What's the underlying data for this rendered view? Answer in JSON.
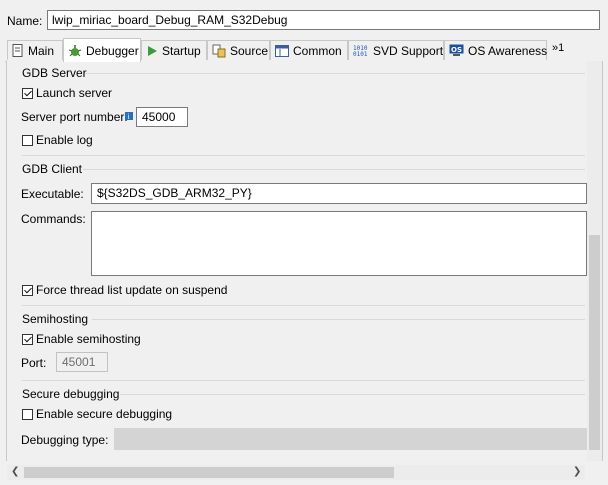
{
  "name_label": "Name:",
  "name_value": "lwip_miriac_board_Debug_RAM_S32Debug",
  "tabs": [
    {
      "label": "Main",
      "icon": "main-icon"
    },
    {
      "label": "Debugger",
      "icon": "debugger-icon"
    },
    {
      "label": "Startup",
      "icon": "startup-icon"
    },
    {
      "label": "Source",
      "icon": "source-icon"
    },
    {
      "label": "Common",
      "icon": "common-icon"
    },
    {
      "label": "SVD Support",
      "icon": "svd-icon"
    },
    {
      "label": "OS Awareness",
      "icon": "os-icon"
    }
  ],
  "tab_overflow": "»1",
  "gdb_server": {
    "title": "GDB Server",
    "launch_server": "Launch server",
    "port_label": "Server port number:",
    "port_value": "45000",
    "enable_log": "Enable log"
  },
  "gdb_client": {
    "title": "GDB Client",
    "executable_label": "Executable:",
    "executable_value": "${S32DS_GDB_ARM32_PY}",
    "commands_label": "Commands:",
    "commands_value": "",
    "force_thread": "Force thread list update on suspend"
  },
  "semihosting": {
    "title": "Semihosting",
    "enable": "Enable semihosting",
    "port_label": "Port:",
    "port_value": "45001"
  },
  "secure": {
    "title": "Secure debugging",
    "enable": "Enable secure debugging",
    "type_label": "Debugging type:",
    "type_value": ""
  },
  "checkbox_states": {
    "launch_server": true,
    "enable_log": false,
    "force_thread": true,
    "enable_semihosting": true,
    "enable_secure": false
  }
}
